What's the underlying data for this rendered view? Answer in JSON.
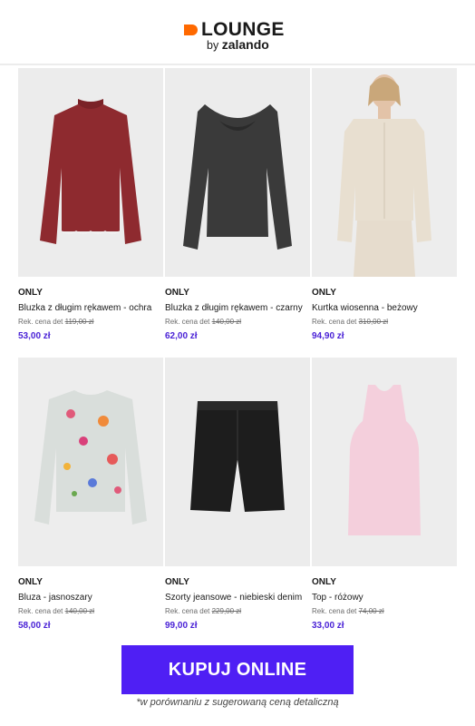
{
  "header": {
    "logo_word": "LOUNGE",
    "logo_by": "by",
    "logo_brand": "zalando",
    "accent": "#ff6900"
  },
  "products": [
    {
      "brand": "ONLY",
      "name": "Bluzka z długim rękawem - ochra",
      "rek_label": "Rek. cena det",
      "rek_price": "119,00 zł",
      "price": "53,00 zł"
    },
    {
      "brand": "ONLY",
      "name": "Bluzka z długim rękawem - czarny",
      "rek_label": "Rek. cena det",
      "rek_price": "140,00 zł",
      "price": "62,00 zł"
    },
    {
      "brand": "ONLY",
      "name": "Kurtka wiosenna - beżowy",
      "rek_label": "Rek. cena det",
      "rek_price": "310,00 zł",
      "price": "94,90 zł"
    },
    {
      "brand": "ONLY",
      "name": "Bluza - jasnoszary",
      "rek_label": "Rek. cena det",
      "rek_price": "140,00 zł",
      "price": "58,00 zł"
    },
    {
      "brand": "ONLY",
      "name": "Szorty jeansowe - niebieski denim",
      "rek_label": "Rek. cena det",
      "rek_price": "229,00 zł",
      "price": "99,00 zł"
    },
    {
      "brand": "ONLY",
      "name": "Top - różowy",
      "rek_label": "Rek. cena det",
      "rek_price": "74,00 zł",
      "price": "33,00 zł"
    }
  ],
  "cta": {
    "label": "KUPUJ ONLINE",
    "color": "#4f1ff4"
  },
  "footnote": "*w porównaniu z sugerowaną ceną detaliczną",
  "price_color": "#4a22d6"
}
